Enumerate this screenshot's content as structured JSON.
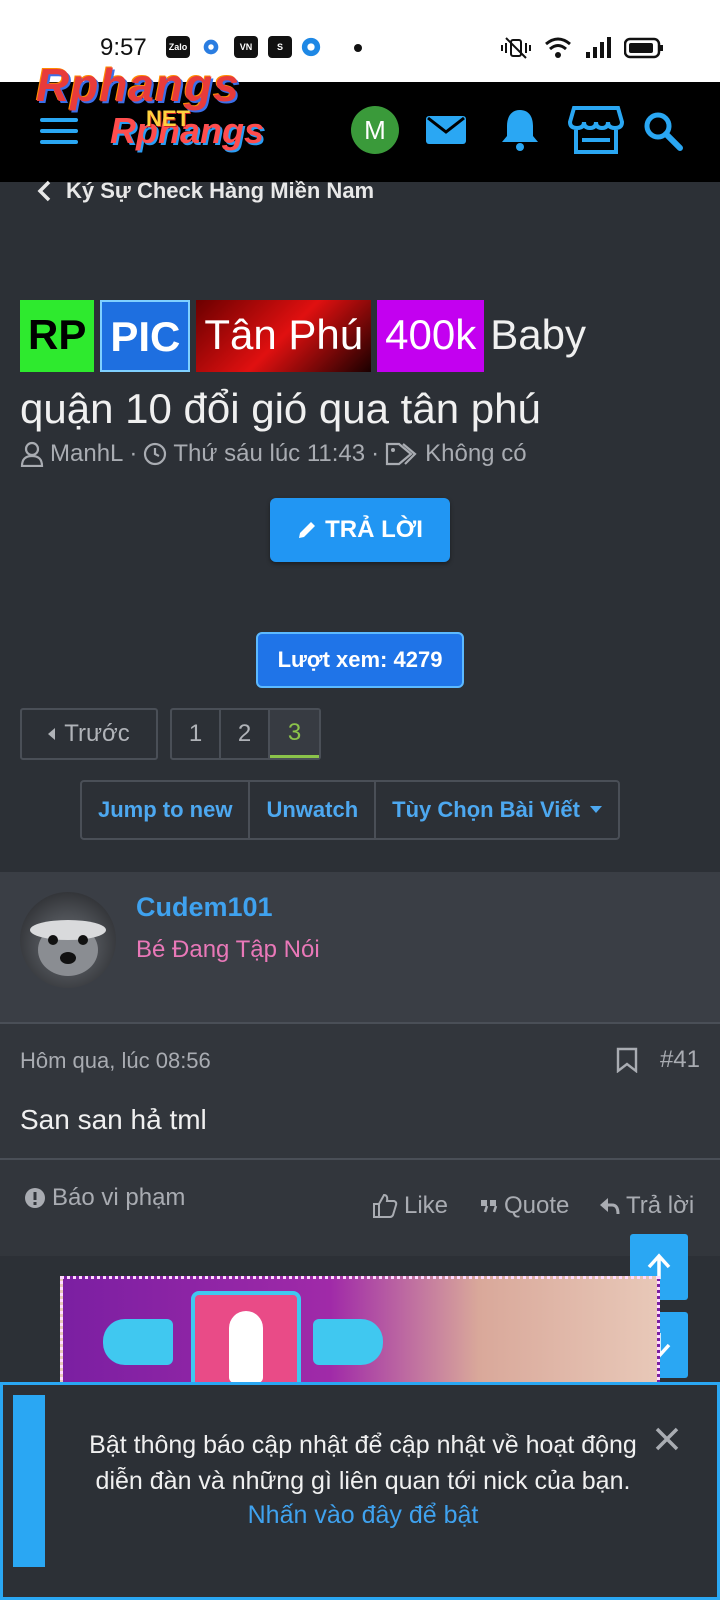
{
  "status_bar": {
    "time": "9:57",
    "app_icons": [
      "Zalo",
      "settings-gear",
      "VN",
      "S",
      "chat"
    ]
  },
  "header": {
    "logo_text": "Rphangs",
    "logo_sub": "Rphangs",
    "logo_net": "NET",
    "avatar_letter": "M"
  },
  "breadcrumb": {
    "label": "Ký Sự Check Hàng Miền Nam"
  },
  "thread": {
    "prefixes": [
      "RP",
      "PIC",
      "Tân Phú",
      "400k"
    ],
    "title_line1": "Baby",
    "title_line2": "quận 10 đổi gió qua tân phú",
    "author": "ManhL",
    "date": "Thứ sáu lúc 11:43",
    "tags": "Không có",
    "reply_button": "TRẢ LỜI",
    "views": "Lượt xem: 4279"
  },
  "pagination": {
    "prev_label": "Trước",
    "pages": [
      "1",
      "2",
      "3"
    ],
    "current": "3"
  },
  "thread_tools": {
    "jump": "Jump to new",
    "unwatch": "Unwatch",
    "options": "Tùy Chọn Bài Viết"
  },
  "post": {
    "username": "Cudem101",
    "user_title": "Bé Đang Tập Nói",
    "date": "Hôm qua, lúc 08:56",
    "number": "#41",
    "content": "San san hả tml",
    "report": "Báo vi phạm",
    "like": "Like",
    "quote": "Quote",
    "reply": "Trả lời"
  },
  "notification": {
    "text": "Bật thông báo cập nhật để cập nhật về hoạt động diễn đàn và những gì liên quan tới nick của bạn.",
    "link": "Nhấn vào đây để bật"
  },
  "colors": {
    "accent": "#2aa7f3",
    "link": "#3fa2ef",
    "page_bg": "#2c3036",
    "user_title": "#e978b8",
    "active_page": "#8bc34a"
  }
}
